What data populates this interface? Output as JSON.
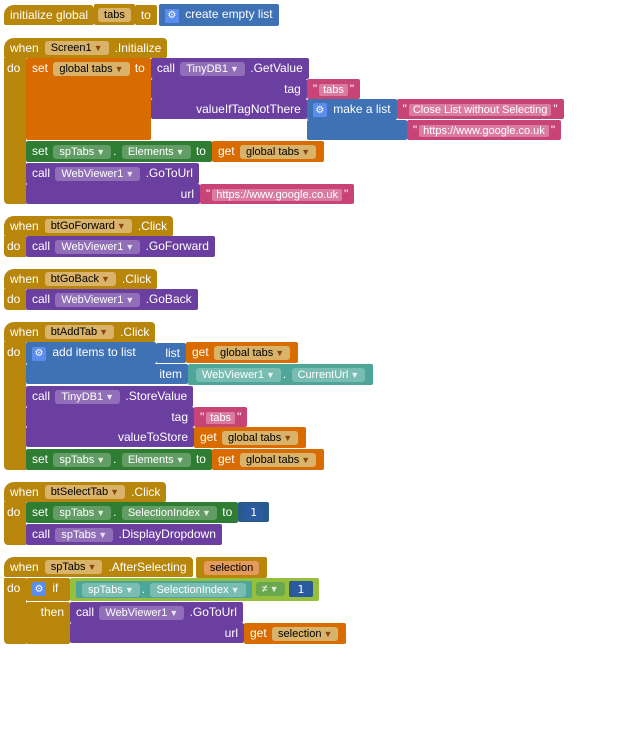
{
  "init": {
    "kw_initialize": "initialize global",
    "var": "tabs",
    "kw_to": "to",
    "create_empty": "create empty list"
  },
  "screen_init": {
    "header_when": "when",
    "component": "Screen1",
    "event": ".Initialize",
    "kw_do": "do",
    "set1": {
      "kw_set": "set",
      "var": "global tabs",
      "kw_to": "to"
    },
    "call1": {
      "kw_call": "call",
      "comp": "TinyDB1",
      "method": ".GetValue",
      "arg_tag": "tag",
      "arg_valif": "valueIfTagNotThere"
    },
    "tag_text": "tabs",
    "make_list": "make a list",
    "list_item1": "Close List without Selecting",
    "list_item2": "https://www.google.co.uk",
    "set2": {
      "kw_set": "set",
      "comp": "spTabs",
      "prop": "Elements",
      "kw_to": "to",
      "kw_get": "get",
      "var": "global tabs"
    },
    "call2": {
      "kw_call": "call",
      "comp": "WebViewer1",
      "method": ".GoToUrl",
      "arg": "url"
    },
    "url_text": "https://www.google.co.uk"
  },
  "goforward": {
    "header_when": "when",
    "comp": "btGoForward",
    "event": ".Click",
    "kw_do": "do",
    "kw_call": "call",
    "target": "WebViewer1",
    "method": ".GoForward"
  },
  "goback": {
    "header_when": "when",
    "comp": "btGoBack",
    "event": ".Click",
    "kw_do": "do",
    "kw_call": "call",
    "target": "WebViewer1",
    "method": ".GoBack"
  },
  "addtab": {
    "header_when": "when",
    "comp": "btAddTab",
    "event": ".Click",
    "kw_do": "do",
    "additems": {
      "label": "add items to list",
      "arg_list": "list",
      "arg_item": "item"
    },
    "get1": {
      "kw_get": "get",
      "var": "global tabs"
    },
    "cururl": {
      "comp": "WebViewer1",
      "prop": "CurrentUrl"
    },
    "store": {
      "kw_call": "call",
      "comp": "TinyDB1",
      "method": ".StoreValue",
      "arg_tag": "tag",
      "arg_val": "valueToStore"
    },
    "tag_text": "tabs",
    "get2": {
      "kw_get": "get",
      "var": "global tabs"
    },
    "set": {
      "kw_set": "set",
      "comp": "spTabs",
      "prop": "Elements",
      "kw_to": "to",
      "kw_get": "get",
      "var": "global tabs"
    }
  },
  "selecttab": {
    "header_when": "when",
    "comp": "btSelectTab",
    "event": ".Click",
    "kw_do": "do",
    "set": {
      "kw_set": "set",
      "comp": "spTabs",
      "prop": "SelectionIndex",
      "kw_to": "to",
      "val": "1"
    },
    "call": {
      "kw_call": "call",
      "comp": "spTabs",
      "method": ".DisplayDropdown"
    }
  },
  "afterselect": {
    "header_when": "when",
    "comp": "spTabs",
    "event": ".AfterSelecting",
    "kw_do": "do",
    "param": "selection",
    "ifblk": {
      "kw_if": "if",
      "kw_then": "then"
    },
    "cond": {
      "comp": "spTabs",
      "prop": "SelectionIndex",
      "op": "≠",
      "val": "1"
    },
    "call": {
      "kw_call": "call",
      "comp": "WebViewer1",
      "method": ".GoToUrl",
      "arg": "url"
    },
    "get": {
      "kw_get": "get",
      "var": "selection"
    }
  }
}
